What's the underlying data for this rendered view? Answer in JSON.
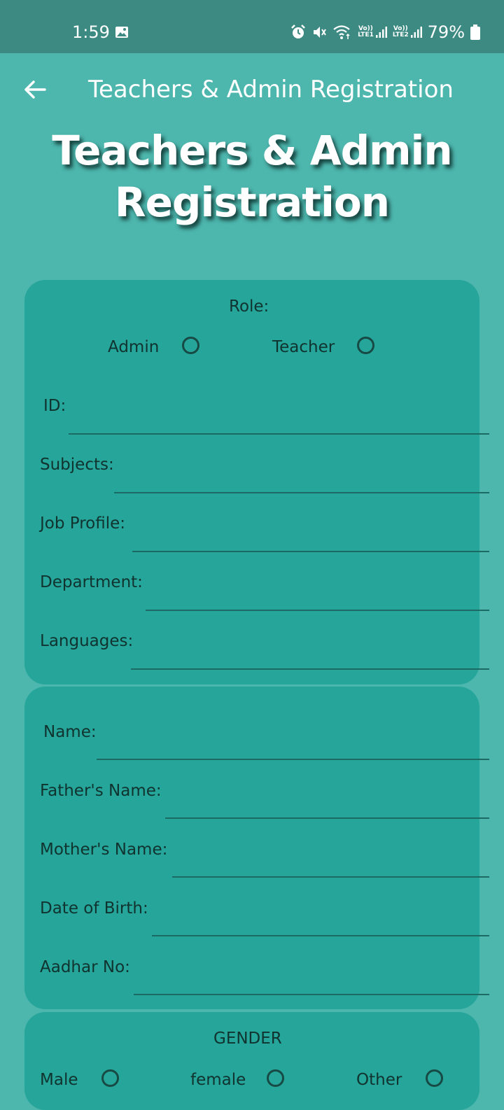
{
  "status_bar": {
    "time": "1:59",
    "sim1_label": "LTE1",
    "sim2_label": "LTE2",
    "battery": "79%"
  },
  "app_bar": {
    "title": "Teachers & Admin Registration"
  },
  "hero": {
    "title": "Teachers & Admin Registration"
  },
  "role_card": {
    "role_label": "Role:",
    "options": [
      "Admin",
      "Teacher"
    ],
    "fields": [
      "ID:",
      "Subjects:",
      "Job Profile:",
      "Department:",
      "Languages:"
    ]
  },
  "personal_card": {
    "fields": [
      "Name:",
      "Father's Name:",
      "Mother's Name:",
      "Date of Birth:",
      "Aadhar No:"
    ]
  },
  "gender_card": {
    "label": "GENDER",
    "options": [
      "Male",
      "female",
      "Other"
    ]
  },
  "colors": {
    "status_bar": "#3d8a83",
    "background": "#4db6ad",
    "card": "#26a59a",
    "text": "#10332f",
    "underline": "#1b6a63"
  }
}
